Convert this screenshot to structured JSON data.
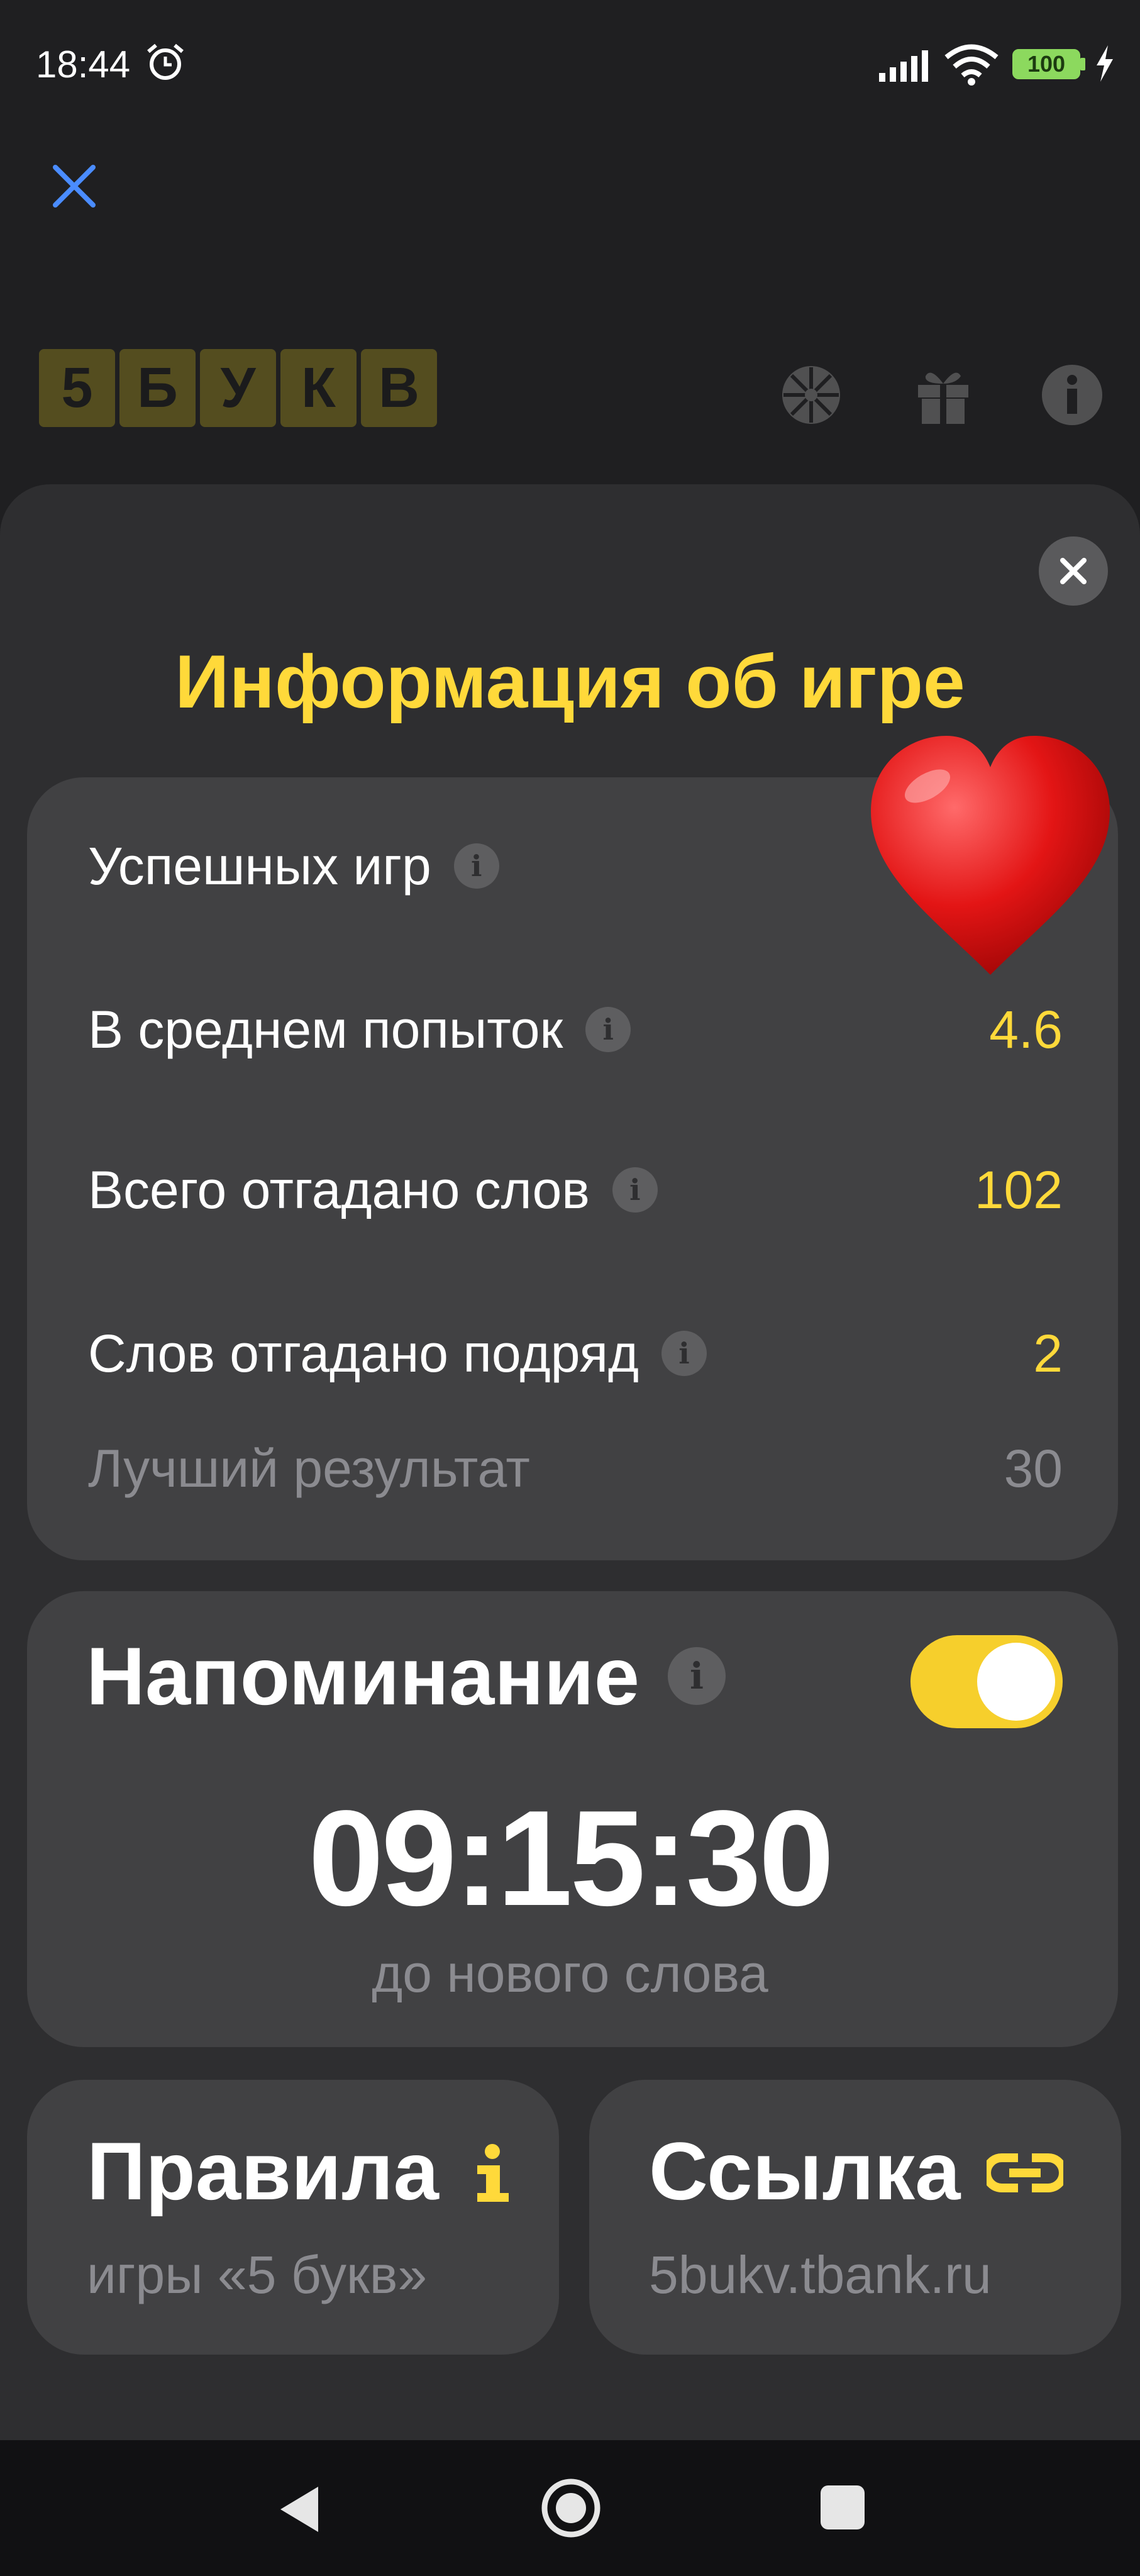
{
  "status_bar": {
    "time": "18:44",
    "battery": "100"
  },
  "header": {
    "logo_tiles": [
      "5",
      "Б",
      "У",
      "К",
      "В"
    ]
  },
  "modal": {
    "title": "Информация об игре",
    "stats": [
      {
        "label": "Успешных игр",
        "value": "",
        "has_info": true
      },
      {
        "label": "В среднем попыток",
        "value": "4.6",
        "has_info": true
      },
      {
        "label": "Всего отгадано слов",
        "value": "102",
        "has_info": true
      },
      {
        "label": "Слов отгадано подряд",
        "value": "2",
        "has_info": true
      },
      {
        "label": "Лучший результат",
        "value": "30",
        "has_info": false
      }
    ],
    "reminder": {
      "title": "Напоминание",
      "enabled": true,
      "timer": "09:15:30",
      "subtitle": "до нового слова"
    },
    "rules": {
      "title": "Правила",
      "subtitle": "игры «5 букв»"
    },
    "link": {
      "title": "Ссылка",
      "subtitle": "5bukv.tbank.ru"
    }
  },
  "colors": {
    "accent": "#ffd93a",
    "toggle": "#f6cf2c",
    "card": "#414143",
    "sheet": "#2e2e30"
  }
}
